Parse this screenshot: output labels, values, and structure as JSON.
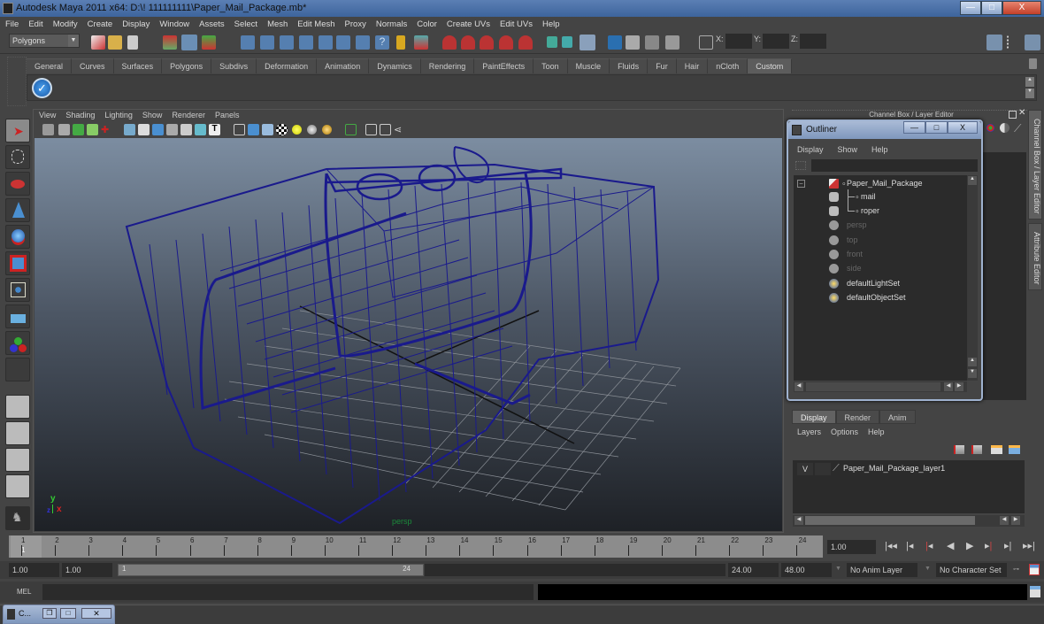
{
  "window": {
    "title": "Autodesk Maya 2011 x64: D:\\! 111111111\\Paper_Mail_Package.mb*",
    "controls": {
      "minimize": "—",
      "maximize": "□",
      "close": "X"
    }
  },
  "menubar": [
    "File",
    "Edit",
    "Modify",
    "Create",
    "Display",
    "Window",
    "Assets",
    "Select",
    "Mesh",
    "Edit Mesh",
    "Proxy",
    "Normals",
    "Color",
    "Create UVs",
    "Edit UVs",
    "Help"
  ],
  "status_line": {
    "menu_set": "Polygons",
    "x_label": "X:",
    "y_label": "Y:",
    "z_label": "Z:",
    "x_value": "",
    "y_value": "",
    "z_value": "",
    "icons": [
      "new-scene-icon",
      "open-scene-icon",
      "save-scene-icon",
      "select-by-hierarchy-icon",
      "select-by-object-icon",
      "select-by-component-icon",
      "select-handles-icon",
      "select-joints-icon",
      "select-curves-icon",
      "select-surfaces-icon",
      "select-deformations-icon",
      "select-dynamics-icon",
      "select-rendering-icon",
      "select-misc-icon",
      "lock-selection-icon",
      "highlight-selection-icon",
      "snap-grid-icon",
      "snap-curve-icon",
      "snap-point-icon",
      "snap-view-plane-icon",
      "make-live-icon",
      "input-ops-icon",
      "output-ops-icon",
      "construction-history-icon",
      "render-view-icon",
      "render-current-frame-icon",
      "ipr-render-icon",
      "render-settings-icon",
      "absolute-transform-icon"
    ],
    "right_icons": [
      "show-hide-attribute-editor-icon",
      "show-hide-tool-settings-icon",
      "show-hide-channel-box-icon"
    ]
  },
  "shelf": {
    "tabs": [
      "General",
      "Curves",
      "Surfaces",
      "Polygons",
      "Subdivs",
      "Deformation",
      "Animation",
      "Dynamics",
      "Rendering",
      "PaintEffects",
      "Toon",
      "Muscle",
      "Fluids",
      "Fur",
      "Hair",
      "nCloth",
      "Custom"
    ],
    "active_tab": "Custom",
    "items": [
      "checkmark-icon"
    ]
  },
  "toolbox": {
    "tools": [
      "select-tool",
      "lasso-tool",
      "paint-select-tool",
      "move-tool",
      "rotate-tool",
      "scale-tool",
      "universal-manipulator",
      "soft-modification-tool",
      "show-manipulator-tool",
      "last-tool-slot"
    ],
    "layouts": [
      "single-perspective-layout",
      "four-view-layout",
      "outliner-persp-layout",
      "persp-graph-layout"
    ],
    "active_tool": "select-tool"
  },
  "viewport": {
    "menu": [
      "View",
      "Shading",
      "Lighting",
      "Show",
      "Renderer",
      "Panels"
    ],
    "camera_label": "persp",
    "axis": {
      "y": "y",
      "x": "x",
      "z": "z"
    },
    "wire_color": "#1a1a8c"
  },
  "channel_box": {
    "title": "Channel Box / Layer Editor",
    "side_tabs": [
      "Channel Box / Layer Editor",
      "Attribute Editor"
    ]
  },
  "outliner": {
    "title": "Outliner",
    "menu": [
      "Display",
      "Show",
      "Help"
    ],
    "filter_value": "",
    "items": [
      {
        "label": "Paper_Mail_Package",
        "icon": "transform-icon",
        "level": 0,
        "dim": false
      },
      {
        "label": "mail",
        "icon": "mesh-icon",
        "level": 1,
        "dim": false
      },
      {
        "label": "roper",
        "icon": "mesh-icon",
        "level": 1,
        "dim": false
      },
      {
        "label": "persp",
        "icon": "camera-icon",
        "level": 0,
        "dim": true
      },
      {
        "label": "top",
        "icon": "camera-icon",
        "level": 0,
        "dim": true
      },
      {
        "label": "front",
        "icon": "camera-icon",
        "level": 0,
        "dim": true
      },
      {
        "label": "side",
        "icon": "camera-icon",
        "level": 0,
        "dim": true
      },
      {
        "label": "defaultLightSet",
        "icon": "set-icon",
        "level": 0,
        "dim": false
      },
      {
        "label": "defaultObjectSet",
        "icon": "set-icon",
        "level": 0,
        "dim": false
      }
    ]
  },
  "layer_editor": {
    "tabs": [
      "Display",
      "Render",
      "Anim"
    ],
    "active_tab": "Display",
    "menu": [
      "Layers",
      "Options",
      "Help"
    ],
    "layers": [
      {
        "visible": "V",
        "name": "Paper_Mail_Package_layer1"
      }
    ]
  },
  "time_slider": {
    "ticks": [
      "1",
      "2",
      "3",
      "4",
      "5",
      "6",
      "7",
      "8",
      "9",
      "10",
      "11",
      "12",
      "13",
      "14",
      "15",
      "16",
      "17",
      "18",
      "19",
      "20",
      "21",
      "22",
      "23",
      "24"
    ],
    "current_frame_marker": "1",
    "current_time": "1.00",
    "playback_buttons": [
      "go-to-start",
      "step-back-frame",
      "step-back-key",
      "play-backwards",
      "play-forwards",
      "step-forward-key",
      "step-forward-frame",
      "go-to-end"
    ]
  },
  "range_slider": {
    "start_time": "1.00",
    "playback_start": "1.00",
    "slider_start": "1",
    "slider_end": "24",
    "playback_end": "24.00",
    "end_time": "48.00",
    "anim_layer": "No Anim Layer",
    "character_set": "No Character Set"
  },
  "command_line": {
    "label": "MEL",
    "value": "",
    "result": ""
  },
  "minimized_window": {
    "label": "C..."
  }
}
